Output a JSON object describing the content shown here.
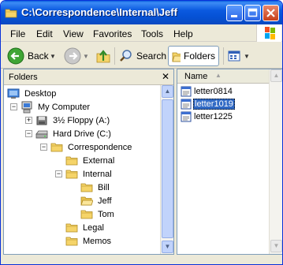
{
  "window": {
    "title": "C:\\Correspondence\\Internal\\Jeff"
  },
  "menu": [
    "File",
    "Edit",
    "View",
    "Favorites",
    "Tools",
    "Help"
  ],
  "toolbar": {
    "back_label": "Back",
    "search_label": "Search",
    "folders_label": "Folders"
  },
  "folders_pane": {
    "title": "Folders",
    "tree": [
      {
        "label": "Desktop",
        "icon": "desktop-icon",
        "level": 0
      },
      {
        "label": "My Computer",
        "icon": "computer-icon",
        "level": 1,
        "expander": "−"
      },
      {
        "label": "3½ Floppy (A:)",
        "icon": "floppy-icon",
        "level": 2,
        "expander": "+"
      },
      {
        "label": "Hard Drive (C:)",
        "icon": "drive-icon",
        "level": 2,
        "expander": "−"
      },
      {
        "label": "Correspondence",
        "icon": "folder-icon",
        "level": 3,
        "expander": "−"
      },
      {
        "label": "External",
        "icon": "folder-icon",
        "level": 4
      },
      {
        "label": "Internal",
        "icon": "folder-icon",
        "level": 4,
        "expander": "−"
      },
      {
        "label": "Bill",
        "icon": "folder-icon",
        "level": 5
      },
      {
        "label": "Jeff",
        "icon": "folder-open-icon",
        "level": 5
      },
      {
        "label": "Tom",
        "icon": "folder-icon",
        "level": 5
      },
      {
        "label": "Legal",
        "icon": "folder-icon",
        "level": 4
      },
      {
        "label": "Memos",
        "icon": "folder-icon",
        "level": 4
      }
    ]
  },
  "files_pane": {
    "column_name": "Name",
    "files": [
      {
        "label": "letter0814",
        "selected": false
      },
      {
        "label": "letter1019",
        "selected": true
      },
      {
        "label": "letter1225",
        "selected": false
      }
    ]
  },
  "colors": {
    "title_blue": "#0a5fde",
    "selection": "#316ac5",
    "folder_yellow": "#f5d469"
  }
}
